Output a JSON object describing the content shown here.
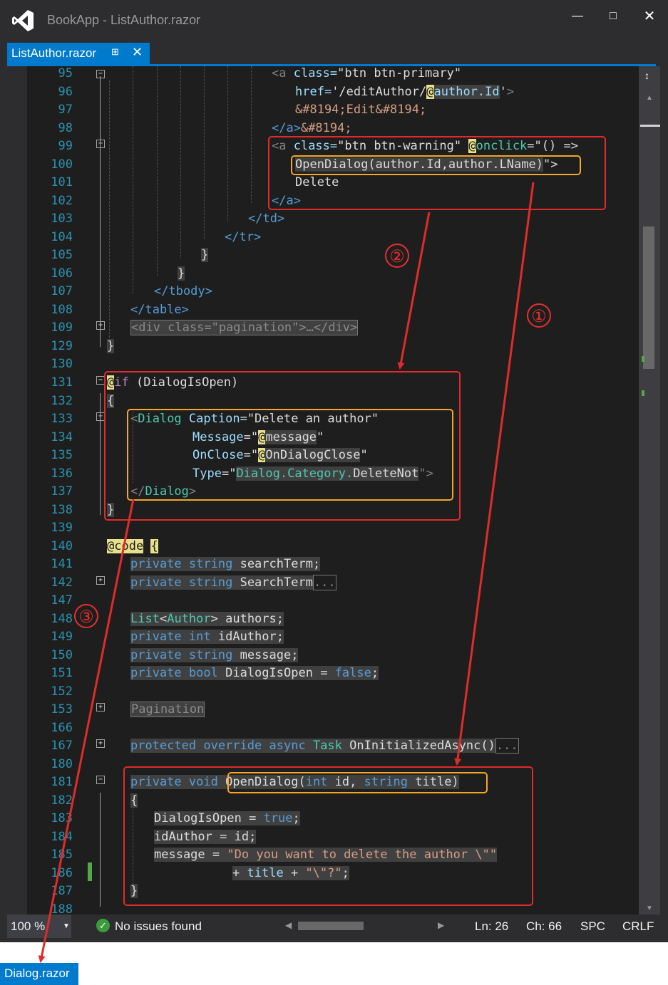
{
  "window": {
    "title": "BookApp - ListAuthor.razor"
  },
  "tab": {
    "label": "ListAuthor.razor"
  },
  "line_numbers": [
    "95",
    "96",
    "97",
    "98",
    "99",
    "100",
    "101",
    "102",
    "103",
    "104",
    "105",
    "106",
    "107",
    "108",
    "109",
    "129",
    "130",
    "131",
    "132",
    "133",
    "134",
    "135",
    "136",
    "137",
    "138",
    "139",
    "140",
    "141",
    "142",
    "147",
    "148",
    "149",
    "150",
    "151",
    "152",
    "153",
    "166",
    "167",
    "180",
    "181",
    "182",
    "183",
    "184",
    "185",
    "186",
    "187",
    "188"
  ],
  "code": {
    "l95_a": "<a",
    "l95_b": " class=",
    "l95_c": "\"btn btn-primary\"",
    "l96_a": "href=",
    "l96_b": "'/editAuthor/",
    "l96_at": "@",
    "l96_c": "author.Id",
    "l96_d": "'",
    "l96_e": ">",
    "l97": "&#8194;Edit&#8194;",
    "l98_a": "</a>",
    "l98_b": "&#8194;",
    "l99_a": "<a",
    "l99_b": " class=",
    "l99_c": "\"btn btn-warning\"",
    "l99_at": "@",
    "l99_d": "onclick",
    "l99_e": "=\"() =>",
    "l100_a": "OpenDialog(author.Id,author.LName)",
    "l100_b": "\">",
    "l101": "Delete",
    "l102": "</a>",
    "l103": "</td>",
    "l104": "</tr>",
    "l105": "}",
    "l106": "}",
    "l107": "</tbody>",
    "l108": "</table>",
    "l109": "<div class=\"pagination\">…</div>",
    "l129": "}",
    "l131_at": "@",
    "l131_a": "if",
    "l131_b": " (DialogIsOpen)",
    "l132": "{",
    "l133_a": "<",
    "l133_b": "Dialog",
    "l133_c": " Caption",
    "l133_d": "=",
    "l133_e": "\"Delete an author\"",
    "l134_a": "Message",
    "l134_b": "=\"",
    "l134_at": "@",
    "l134_c": "message",
    "l134_d": "\"",
    "l135_a": "OnClose",
    "l135_b": "=\"",
    "l135_at": "@",
    "l135_c": "OnDialogClose",
    "l135_d": "\"",
    "l136_a": "Type",
    "l136_b": "=\"",
    "l136_c": "Dialog.Category.",
    "l136_d": "DeleteNot",
    "l136_e": "\">",
    "l137_a": "</",
    "l137_b": "Dialog",
    "l137_c": ">",
    "l138": "}",
    "l140_at": "@",
    "l140_a": "code",
    "l140_b": "{",
    "l141_a": "private",
    "l141_b": "string",
    "l141_c": "searchTerm;",
    "l142_a": "private",
    "l142_b": "string",
    "l142_c": "SearchTerm",
    "l142_d": "...",
    "l148_a": "List",
    "l148_b": "<",
    "l148_c": "Author",
    "l148_d": ">",
    "l148_e": " authors;",
    "l149_a": "private",
    "l149_b": "int",
    "l149_c": "idAuthor;",
    "l150_a": "private",
    "l150_b": "string",
    "l150_c": "message;",
    "l151_a": "private",
    "l151_b": "bool",
    "l151_c": "DialogIsOpen",
    "l151_d": "=",
    "l151_e": "false",
    "l153": "Pagination",
    "l167_a": "protected",
    "l167_b": "override",
    "l167_c": "async",
    "l167_d": "Task",
    "l167_e": "OnInitializedAsync()",
    "l167_f": "...",
    "l181_a": "private",
    "l181_b": "void",
    "l181_c": "OpenDialog(",
    "l181_d": "int",
    "l181_e": " id, ",
    "l181_f": "string",
    "l181_g": " title)",
    "l182": "{",
    "l183_a": "DialogIsOpen",
    "l183_b": "=",
    "l183_c": "true",
    "l184_a": "idAuthor",
    "l184_b": "=",
    "l184_c": "id;",
    "l185_a": "message",
    "l185_b": "=",
    "l185_c": "\"Do you want to delete the author \\\"\"",
    "l186_a": "+",
    "l186_b": "title",
    "l186_c": "+",
    "l186_d": "\"\\\"?\"",
    "l187": "}"
  },
  "annotations": {
    "one": "①",
    "two": "②",
    "three": "③"
  },
  "status": {
    "zoom": "100 %",
    "issues": "No issues found",
    "ln": "Ln: 26",
    "ch": "Ch: 66",
    "spc": "SPC",
    "crlf": "CRLF"
  },
  "linked_file": "Dialog.razor",
  "colors": {
    "accent": "#007acc",
    "annotation_red": "#e12b2b",
    "annotation_orange": "#f5a623"
  }
}
